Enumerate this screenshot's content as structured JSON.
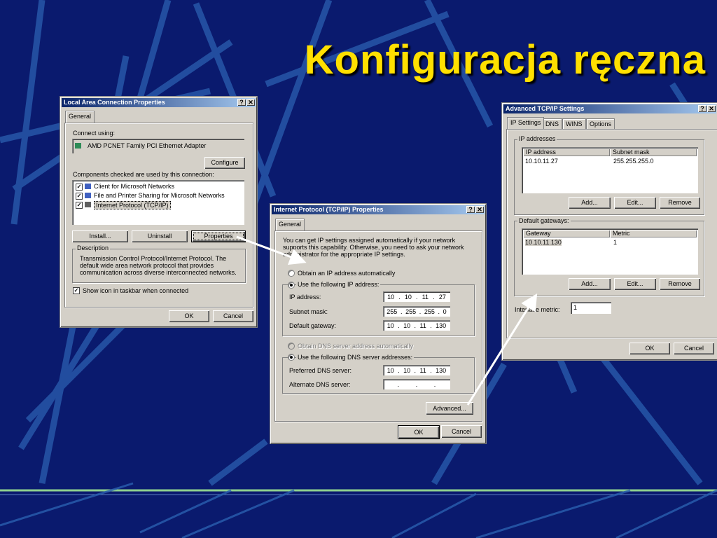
{
  "slide": {
    "title": "Konfiguracja ręczna"
  },
  "win1": {
    "title": "Local Area Connection Properties",
    "help": "?",
    "close": "✕",
    "tab": "General",
    "connect_label": "Connect using:",
    "adapter": "AMD PCNET Family PCI Ethernet Adapter",
    "configure": "Configure",
    "components_label": "Components checked are used by this connection:",
    "components": [
      {
        "label": "Client for Microsoft Networks",
        "checked": true
      },
      {
        "label": "File and Printer Sharing for Microsoft Networks",
        "checked": true
      },
      {
        "label": "Internet Protocol (TCP/IP)",
        "checked": true
      }
    ],
    "install": "Install...",
    "uninstall": "Uninstall",
    "properties": "Properties",
    "description_label": "Description",
    "description": "Transmission Control Protocol/Internet Protocol. The default wide area network protocol that provides communication across diverse interconnected networks.",
    "show_icon": "Show icon in taskbar when connected",
    "ok": "OK",
    "cancel": "Cancel"
  },
  "win2": {
    "title": "Internet Protocol (TCP/IP) Properties",
    "help": "?",
    "close": "✕",
    "tab": "General",
    "intro": "You can get IP settings assigned automatically if your network supports this capability. Otherwise, you need to ask your network administrator for the appropriate IP settings.",
    "obtain_ip": "Obtain an IP address automatically",
    "use_ip": "Use the following IP address:",
    "ip_label": "IP address:",
    "ip": [
      "10",
      "10",
      "11",
      "27"
    ],
    "mask_label": "Subnet mask:",
    "mask": [
      "255",
      "255",
      "255",
      "0"
    ],
    "gateway_label": "Default gateway:",
    "gateway": [
      "10",
      "10",
      "11",
      "130"
    ],
    "obtain_dns": "Obtain DNS server address automatically",
    "use_dns": "Use the following DNS server addresses:",
    "pref_dns_label": "Preferred DNS server:",
    "pref_dns": [
      "10",
      "10",
      "11",
      "130"
    ],
    "alt_dns_label": "Alternate DNS server:",
    "alt_dns": [
      "",
      "",
      "",
      ""
    ],
    "advanced": "Advanced...",
    "ok": "OK",
    "cancel": "Cancel"
  },
  "win3": {
    "title": "Advanced TCP/IP Settings",
    "help": "?",
    "close": "✕",
    "tabs": [
      "IP Settings",
      "DNS",
      "WINS",
      "Options"
    ],
    "ip_group": "IP addresses",
    "ip_col1": "IP address",
    "ip_col2": "Subnet mask",
    "ip_rows": [
      {
        "ip": "10.10.11.27",
        "mask": "255.255.255.0"
      }
    ],
    "gw_group": "Default gateways:",
    "gw_col1": "Gateway",
    "gw_col2": "Metric",
    "gw_rows": [
      {
        "gw": "10.10.11.130",
        "metric": "1"
      }
    ],
    "add": "Add...",
    "edit": "Edit...",
    "remove": "Remove",
    "metric_label": "Interface metric:",
    "metric_value": "1",
    "ok": "OK",
    "cancel": "Cancel"
  }
}
